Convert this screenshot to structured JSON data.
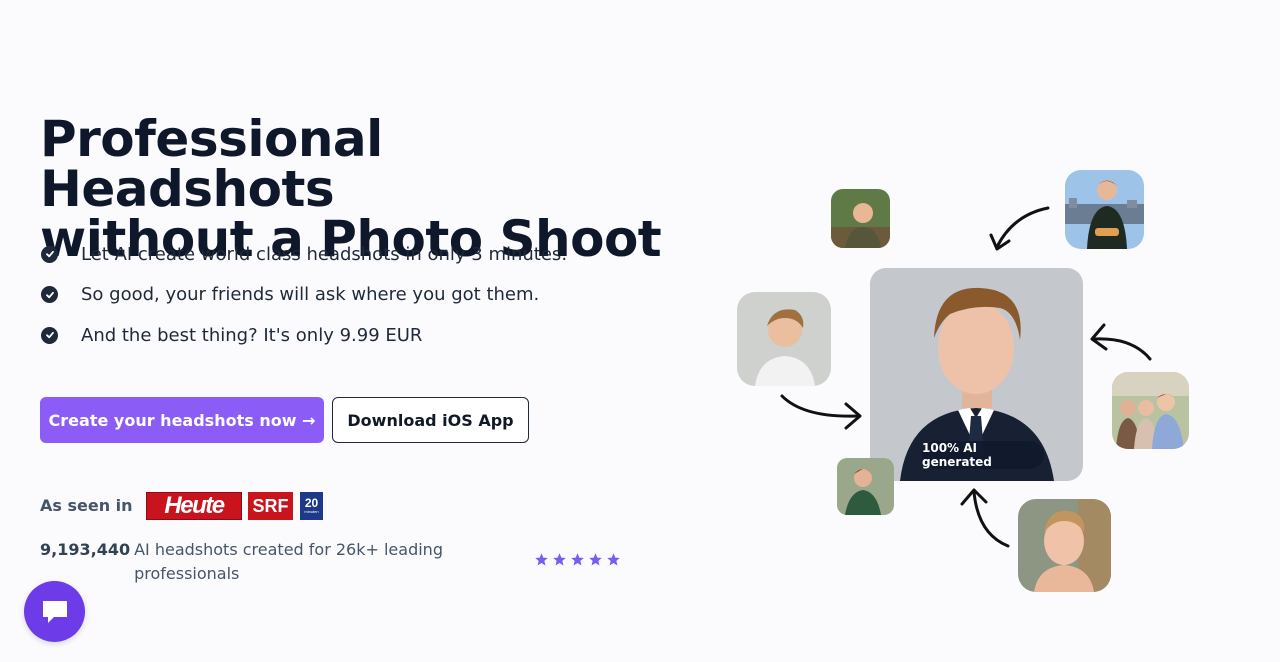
{
  "hero": {
    "title_line1": "Professional Headshots",
    "title_line2": "without a Photo Shoot"
  },
  "features": [
    "Let AI create world class headshots in only 3 minutes.",
    "So good, your friends will ask where you got them.",
    "And the best thing? It's only 9.99 EUR"
  ],
  "buttons": {
    "primary_label": "Create your headshots now →",
    "secondary_label": "Download iOS App"
  },
  "press": {
    "label": "As seen in",
    "logos": [
      "Heute",
      "SRF",
      "20"
    ],
    "logo_20_sub": "minuten"
  },
  "stats": {
    "count": "9,193,440",
    "text": "AI headshots created for 26k+ leading professionals"
  },
  "rating": {
    "stars": 5,
    "max": 5,
    "color": "#7c5cf0"
  },
  "illustration": {
    "badge": "100% AI generated"
  },
  "colors": {
    "accent": "#8b5cf6",
    "chat": "#6d3be8",
    "text_dark": "#0f172a",
    "text_muted": "#475569"
  },
  "icons": [
    "check-circle-icon",
    "star-icon",
    "chat-icon",
    "arrow-icon"
  ]
}
